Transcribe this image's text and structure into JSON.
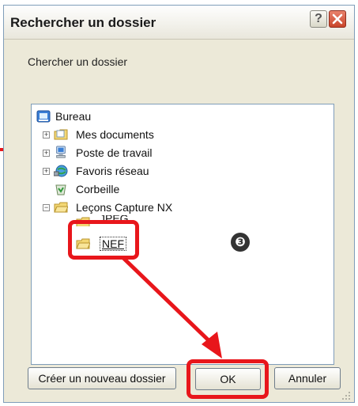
{
  "dialog": {
    "title": "Rechercher un dossier",
    "help_label": "?",
    "instruction": "Chercher un dossier"
  },
  "tree": {
    "items": [
      {
        "label": "Bureau",
        "icon": "desktop-icon",
        "expander": ""
      },
      {
        "label": "Mes documents",
        "icon": "documents-folder-icon",
        "expander": "+"
      },
      {
        "label": "Poste de travail",
        "icon": "computer-icon",
        "expander": "+"
      },
      {
        "label": "Favoris réseau",
        "icon": "network-icon",
        "expander": "+"
      },
      {
        "label": "Corbeille",
        "icon": "recycle-bin-icon",
        "expander": ""
      },
      {
        "label": "Leçons Capture NX",
        "icon": "folder-open-icon",
        "expander": "−"
      },
      {
        "label": "JPEG",
        "icon": "folder-icon",
        "expander": ""
      },
      {
        "label": "NEF",
        "icon": "folder-icon",
        "expander": "",
        "selected": true
      }
    ]
  },
  "buttons": {
    "new_folder": "Créer un nouveau dossier",
    "ok": "OK",
    "cancel": "Annuler"
  },
  "annotation": {
    "step_number": "❸",
    "color": "#e8161b"
  },
  "colors": {
    "dialog_bg": "#ece9d8",
    "close_red": "#c9452a",
    "highlight_red": "#e8161b"
  }
}
